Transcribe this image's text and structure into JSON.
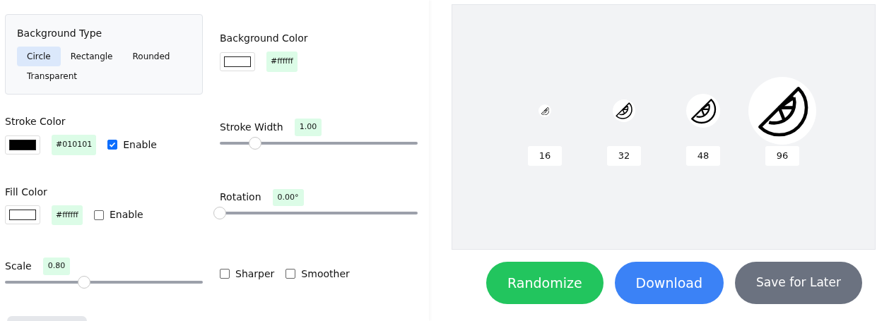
{
  "background_type": {
    "label": "Background Type",
    "options": [
      {
        "label": "Circle",
        "selected": true
      },
      {
        "label": "Rectangle",
        "selected": false
      },
      {
        "label": "Rounded",
        "selected": false
      },
      {
        "label": "Transparent",
        "selected": false
      }
    ]
  },
  "background_color": {
    "label": "Background Color",
    "value": "#ffffff"
  },
  "stroke_color": {
    "label": "Stroke Color",
    "value": "#010101",
    "enable_label": "Enable",
    "checked": true
  },
  "stroke_width": {
    "label": "Stroke Width",
    "reading": "1.00",
    "level": 0.18
  },
  "fill_color": {
    "label": "Fill Color",
    "value": "#ffffff",
    "enable_label": "Enable",
    "checked": false
  },
  "rotation": {
    "label": "Rotation",
    "reading": "0.00°",
    "level": 0
  },
  "scale": {
    "label": "Scale",
    "reading": "0.80",
    "level": 0.4
  },
  "options": [
    {
      "label": "Sharper",
      "checked": false
    },
    {
      "label": "Smoother",
      "checked": false
    }
  ],
  "preview": {
    "sizes": [
      "16",
      "32",
      "48",
      "96"
    ]
  },
  "buttons": [
    {
      "label": "Randomize",
      "kind": "success"
    },
    {
      "label": "Download",
      "kind": "primary"
    },
    {
      "label": "Save for Later",
      "kind": "secondary"
    }
  ]
}
